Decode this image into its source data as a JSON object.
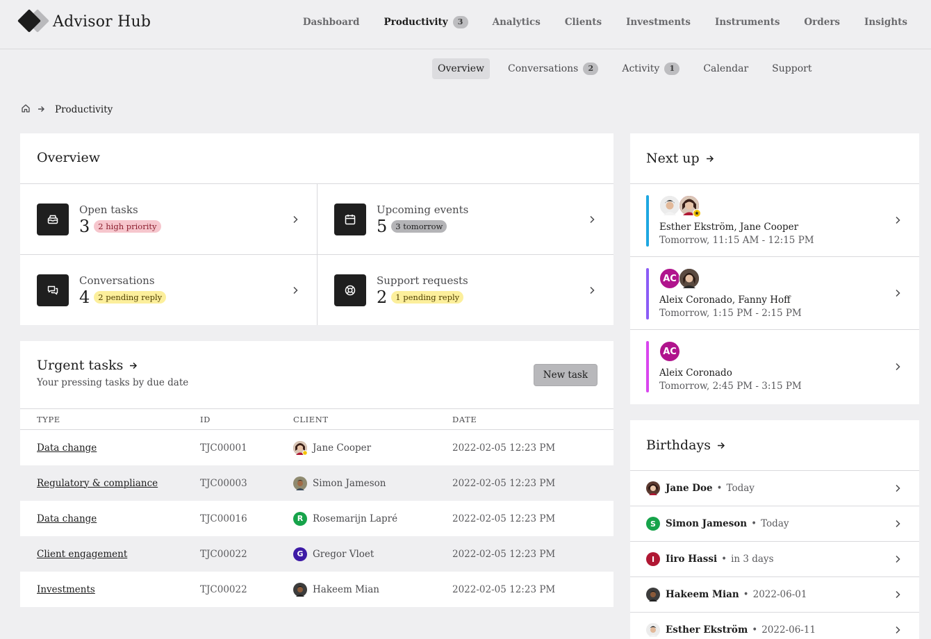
{
  "app": {
    "title": "Advisor Hub"
  },
  "nav": [
    {
      "label": "Dashboard"
    },
    {
      "label": "Productivity",
      "badge": "3"
    },
    {
      "label": "Analytics"
    },
    {
      "label": "Clients"
    },
    {
      "label": "Investments"
    },
    {
      "label": "Instruments"
    },
    {
      "label": "Orders"
    },
    {
      "label": "Insights"
    }
  ],
  "subnav": [
    {
      "label": "Overview"
    },
    {
      "label": "Conversations",
      "badge": "2"
    },
    {
      "label": "Activity",
      "badge": "1"
    },
    {
      "label": "Calendar"
    },
    {
      "label": "Support"
    }
  ],
  "breadcrumb": {
    "current": "Productivity"
  },
  "overview": {
    "title": "Overview",
    "tiles": [
      {
        "label": "Open tasks",
        "value": "3",
        "pill": "2 high priority"
      },
      {
        "label": "Upcoming events",
        "value": "5",
        "pill": "3 tomorrow"
      },
      {
        "label": "Conversations",
        "value": "4",
        "pill": "2 pending reply"
      },
      {
        "label": "Support requests",
        "value": "2",
        "pill": "1 pending reply"
      }
    ]
  },
  "urgent": {
    "title": "Urgent tasks",
    "subtitle": "Your pressing tasks by due date",
    "new_task": "New task",
    "headers": {
      "type": "TYPE",
      "id": "ID",
      "client": "CLIENT",
      "date": "DATE"
    },
    "rows": [
      {
        "type": "Data change",
        "id": "TJC00001",
        "client": "Jane Cooper",
        "date": "2022-02-05 12:23 PM"
      },
      {
        "type": "Regulatory & compliance",
        "id": "TJC00003",
        "client": "Simon Jameson",
        "date": "2022-02-05 12:23 PM"
      },
      {
        "type": "Data change",
        "id": "TJC00016",
        "client": "Rosemarijn Lapré",
        "initial": "R",
        "date": "2022-02-05 12:23 PM"
      },
      {
        "type": "Client engagement",
        "id": "TJC00022",
        "client": "Gregor Vloet",
        "initial": "G",
        "date": "2022-02-05 12:23 PM"
      },
      {
        "type": "Investments",
        "id": "TJC00022",
        "client": "Hakeem Mian",
        "date": "2022-02-05 12:23 PM"
      }
    ]
  },
  "next_up": {
    "title": "Next up",
    "items": [
      {
        "names": "Esther Ekström, Jane Cooper",
        "time": "Tomorrow, 11:15 AM - 12:15 PM"
      },
      {
        "names": "Aleix Coronado, Fanny Hoff",
        "time": "Tomorrow, 1:15 PM - 2:15 PM",
        "initials": "AC"
      },
      {
        "names": "Aleix Coronado",
        "time": "Tomorrow, 2:45 PM - 3:15 PM",
        "initials": "AC"
      }
    ]
  },
  "birthdays": {
    "title": "Birthdays",
    "items": [
      {
        "name": "Jane Doe",
        "when": "Today"
      },
      {
        "name": "Simon Jameson",
        "when": "Today",
        "initial": "S"
      },
      {
        "name": "Iiro Hassi",
        "when": "in 3 days",
        "initial": "I"
      },
      {
        "name": "Hakeem Mian",
        "when": "2022-06-01"
      },
      {
        "name": "Esther Ekström",
        "when": "2022-06-11"
      }
    ]
  },
  "colors": {
    "bar_blue": "#1ea7e1",
    "bar_purple": "#8b5cf6",
    "bar_magenta": "#d946ef",
    "avatar_magenta": "#b0148d",
    "avatar_green": "#16a34a",
    "avatar_indigo": "#3d1aa6",
    "avatar_red": "#b01733"
  }
}
